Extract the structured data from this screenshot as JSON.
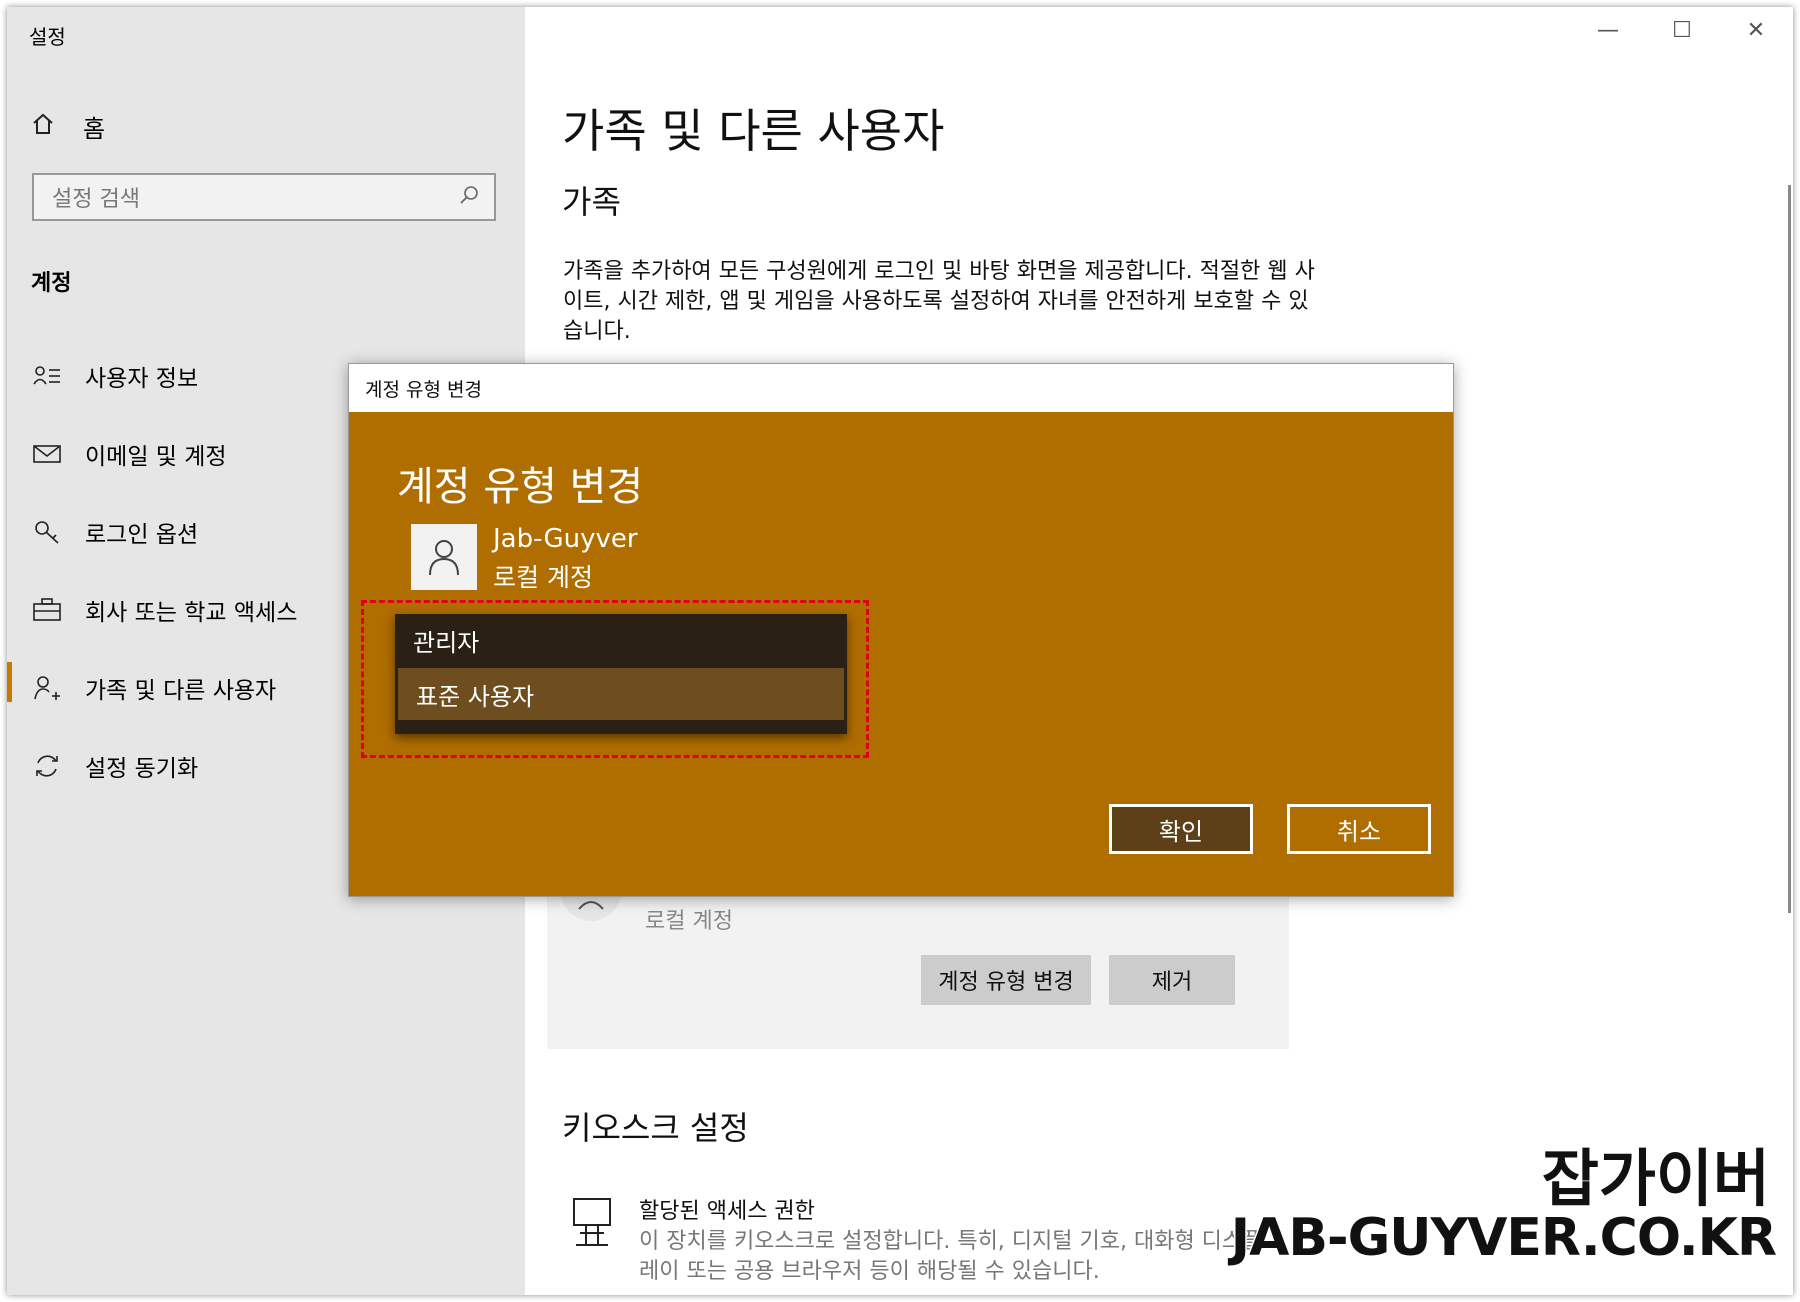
{
  "window": {
    "title": "설정",
    "controls": {
      "minimize": "—",
      "maximize": "☐",
      "close": "✕"
    }
  },
  "sidebar": {
    "home_label": "홈",
    "search_placeholder": "설정 검색",
    "section_label": "계정",
    "items": [
      {
        "label": "사용자 정보",
        "icon": "user-info-icon"
      },
      {
        "label": "이메일 및 계정",
        "icon": "mail-icon"
      },
      {
        "label": "로그인 옵션",
        "icon": "key-icon"
      },
      {
        "label": "회사 또는 학교 액세스",
        "icon": "briefcase-icon"
      },
      {
        "label": "가족 및 다른 사용자",
        "icon": "person-add-icon",
        "active": true
      },
      {
        "label": "설정 동기화",
        "icon": "sync-icon"
      }
    ]
  },
  "main": {
    "title": "가족 및 다른 사용자",
    "family_heading": "가족",
    "family_desc": "가족을 추가하여 모든 구성원에게 로그인 및 바탕 화면을 제공합니다. 적절한 웹 사이트, 시간 제한, 앱 및 게임을 사용하도록 설정하여 자녀를 안전하게 보호할 수 있습니다.",
    "user_card": {
      "account_type": "로컬 계정",
      "change_type_button": "계정 유형 변경",
      "remove_button": "제거"
    },
    "kiosk_heading": "키오스크 설정",
    "kiosk_item_title": "할당된 액세스 권한",
    "kiosk_item_desc": "이 장치를 키오스크로 설정합니다. 특히, 디지털 기호, 대화형 디스플레이 또는 공용 브라우저 등이 해당될 수 있습니다."
  },
  "dialog": {
    "window_title": "계정 유형 변경",
    "heading": "계정 유형 변경",
    "user_name": "Jab-Guyver",
    "user_account": "로컬 계정",
    "options": [
      "관리자",
      "표준 사용자"
    ],
    "selected_option": "표준 사용자",
    "ok_button": "확인",
    "cancel_button": "취소",
    "accent_color": "#b06d00"
  },
  "watermark": {
    "korean": "잡가이버",
    "url": "JAB-GUYVER.CO.KR"
  }
}
